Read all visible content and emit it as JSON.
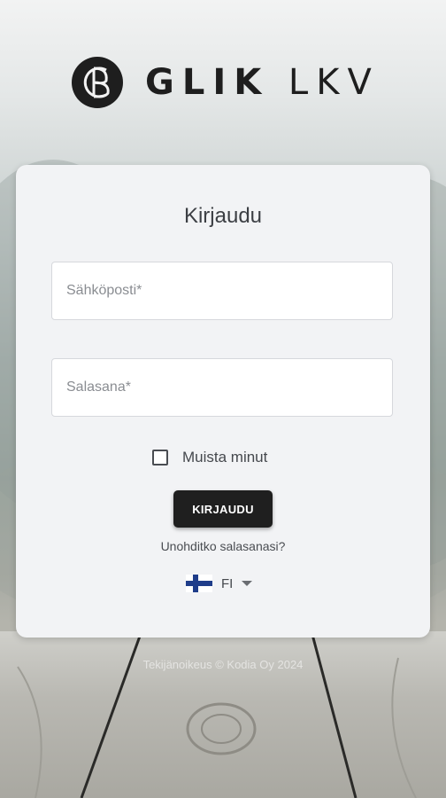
{
  "brand": {
    "name_bold": "GLIK",
    "name_light": "LKV",
    "logo_icon": "glik-monogram-icon"
  },
  "login": {
    "title": "Kirjaudu",
    "email_placeholder": "Sähköposti*",
    "password_placeholder": "Salasana*",
    "remember_label": "Muista minut",
    "remember_checked": false,
    "submit_label": "KIRJAUDU",
    "forgot_label": "Unohditko salasanasi?"
  },
  "language": {
    "code": "FI",
    "flag_icon": "finland-flag-icon",
    "dropdown_icon": "caret-down-icon"
  },
  "footer": {
    "copyright": "Tekijänoikeus © Kodia Oy 2024"
  },
  "colors": {
    "button_bg": "#1f1f1f",
    "card_bg": "#f2f3f5",
    "flag_blue": "#1f3d8a"
  }
}
